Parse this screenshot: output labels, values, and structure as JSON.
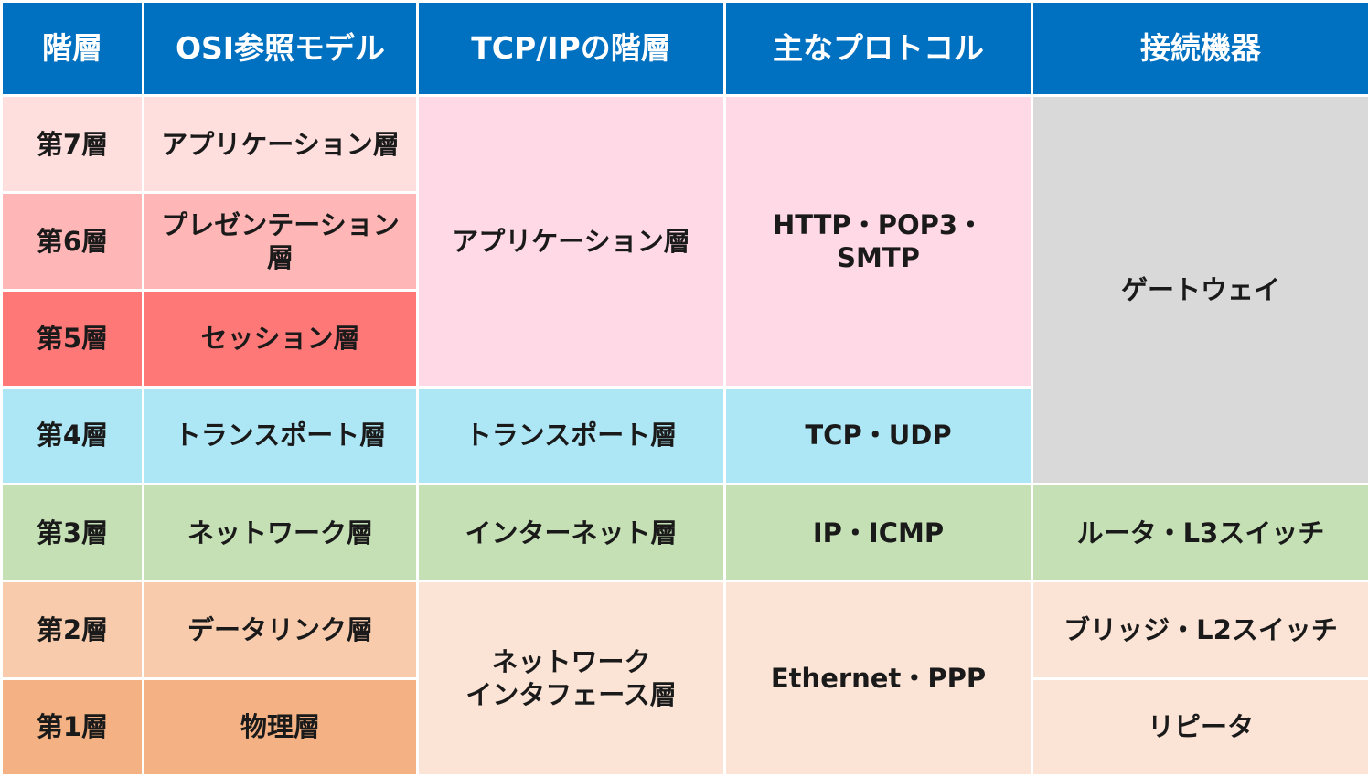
{
  "headers": {
    "layer": "階層",
    "osi": "OSI参照モデル",
    "tcpip": "TCP/IPの階層",
    "protocols": "主なプロトコル",
    "devices": "接続機器"
  },
  "rows": {
    "l7": {
      "layer": "第7層",
      "osi": "アプリケーション層"
    },
    "l6": {
      "layer": "第6層",
      "osi": "プレゼンテーション層"
    },
    "l5": {
      "layer": "第5層",
      "osi": "セッション層"
    },
    "l4": {
      "layer": "第4層",
      "osi": "トランスポート層"
    },
    "l3": {
      "layer": "第3層",
      "osi": "ネットワーク層"
    },
    "l2": {
      "layer": "第2層",
      "osi": "データリンク層"
    },
    "l1": {
      "layer": "第1層",
      "osi": "物理層"
    }
  },
  "tcpip": {
    "application": "アプリケーション層",
    "transport": "トランスポート層",
    "internet": "インターネット層",
    "network_interface_line1": "ネットワーク",
    "network_interface_line2": "インタフェース層"
  },
  "protocols": {
    "application": "HTTP・POP3・SMTP",
    "transport": "TCP・UDP",
    "internet": "IP・ICMP",
    "network_interface": "Ethernet・PPP"
  },
  "devices": {
    "gateway": "ゲートウェイ",
    "router": "ルータ・L3スイッチ",
    "bridge": "ブリッジ・L2スイッチ",
    "repeater": "リピータ"
  },
  "colors": {
    "header": "#0070c0",
    "layer7": "#ffdede",
    "layer6": "#ffb6b6",
    "layer5": "#ff7878",
    "application_group": "#ffd9e6",
    "transport_group": "#ade7f6",
    "gateway": "#d9d9d9",
    "internet_group": "#c5e0b4",
    "layer2": "#f8cbad",
    "layer1": "#f4b183",
    "network_interface_group": "#fbe3d6"
  }
}
